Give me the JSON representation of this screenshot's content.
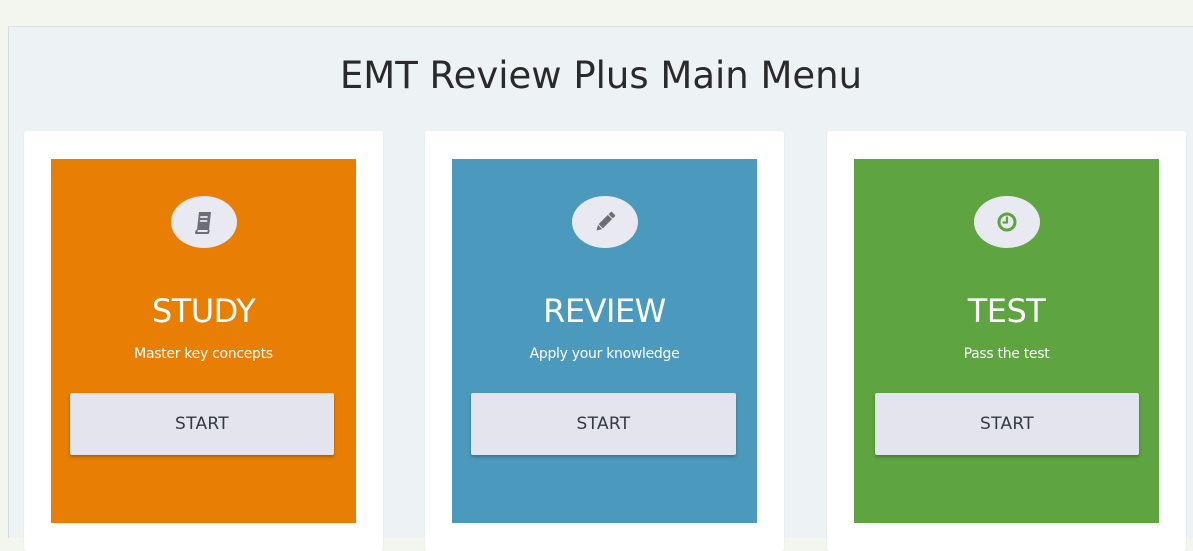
{
  "title": "EMT Review Plus Main Menu",
  "cards": [
    {
      "heading": "STUDY",
      "subtitle": "Master key concepts",
      "button_label": "START",
      "icon": "book-icon",
      "color": "#e87e04"
    },
    {
      "heading": "REVIEW",
      "subtitle": "Apply your knowledge",
      "button_label": "START",
      "icon": "pencil-icon",
      "color": "#4b9abd"
    },
    {
      "heading": "TEST",
      "subtitle": "Pass the test",
      "button_label": "START",
      "icon": "clock-icon",
      "color": "#5ea440"
    }
  ],
  "colors": {
    "icon_glyph": "#6b6f73",
    "icon_background": "#e9e9f1",
    "button_background": "#e4e4ee",
    "page_background": "#edf2f5"
  }
}
